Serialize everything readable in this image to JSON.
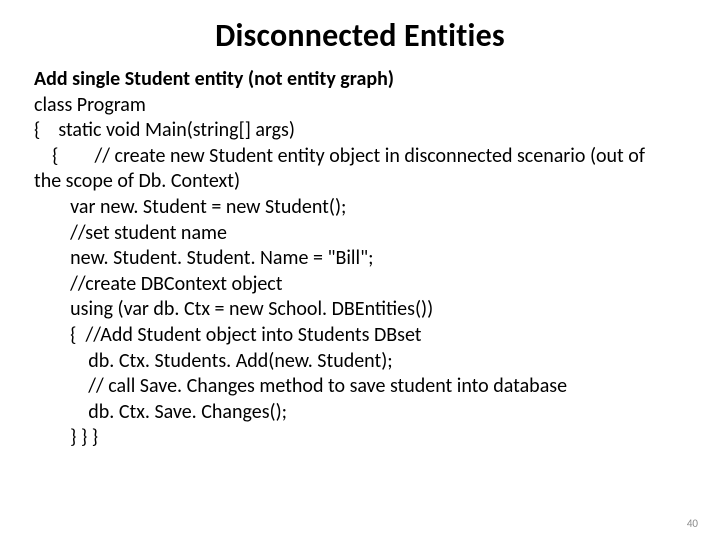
{
  "title": "Disconnected Entities",
  "subheading": "Add single Student entity (not entity graph)",
  "lines": {
    "l1": "class Program",
    "l2": "{    static void Main(string[] args)",
    "l3": "    {        // create new Student entity object in disconnected scenario (out of",
    "l4": "the scope of Db. Context)",
    "l5": "        var new. Student = new Student();",
    "l6": "        //set student name",
    "l7": "        new. Student. Student. Name = \"Bill\";",
    "l8": "        //create DBContext object",
    "l9": "        using (var db. Ctx = new School. DBEntities())",
    "l10": "        {  //Add Student object into Students DBset",
    "l11": "            db. Ctx. Students. Add(new. Student);",
    "l12": "            // call Save. Changes method to save student into database",
    "l13": "            db. Ctx. Save. Changes();",
    "l14": "        } } }"
  },
  "page_number": "40"
}
